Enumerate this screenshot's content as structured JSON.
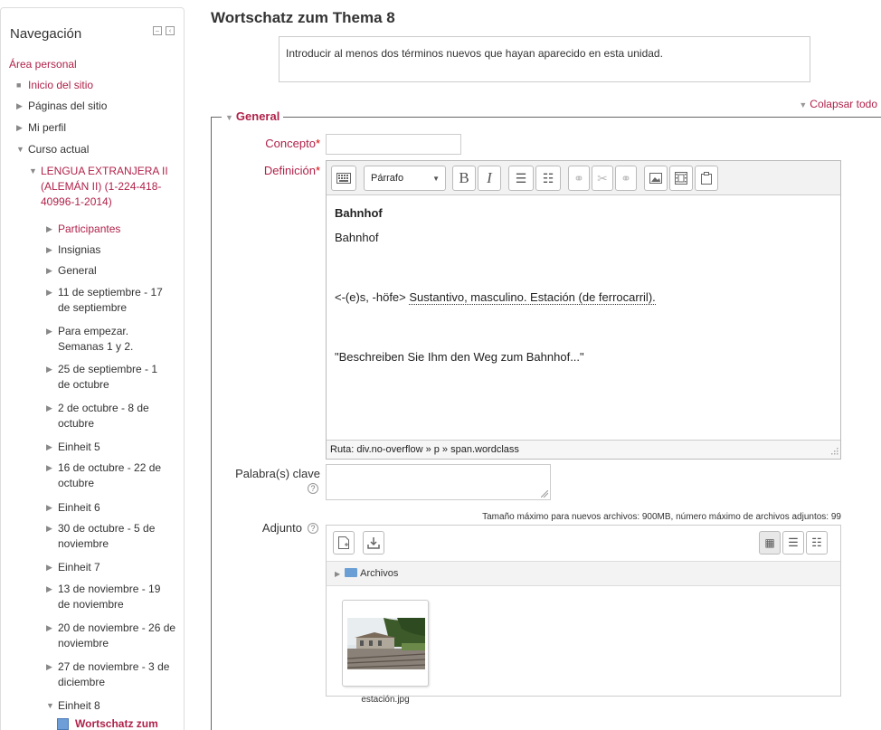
{
  "nav": {
    "title": "Navegación",
    "personal_area": "Área personal",
    "items": [
      {
        "label": "Inicio del sitio"
      },
      {
        "label": "Páginas del sitio"
      },
      {
        "label": "Mi perfil"
      },
      {
        "label": "Curso actual"
      },
      {
        "label": "LENGUA EXTRANJERA II (ALEMÁN II) (1-224-418-40996-1-2014)"
      },
      {
        "label": "Participantes"
      },
      {
        "label": "Insignias"
      },
      {
        "label": "General"
      },
      {
        "label": "11 de septiembre - 17 de septiembre"
      },
      {
        "label": "Para empezar. Semanas 1 y 2."
      },
      {
        "label": "25 de septiembre - 1 de octubre"
      },
      {
        "label": "2 de octubre - 8 de octubre"
      },
      {
        "label": "Einheit 5"
      },
      {
        "label": "16 de octubre - 22 de octubre"
      },
      {
        "label": "Einheit 6"
      },
      {
        "label": "30 de octubre - 5 de noviembre"
      },
      {
        "label": "Einheit 7"
      },
      {
        "label": "13 de noviembre - 19 de noviembre"
      },
      {
        "label": "20 de noviembre - 26 de noviembre"
      },
      {
        "label": "27 de noviembre - 3 de diciembre"
      },
      {
        "label": "Einheit 8"
      },
      {
        "label": "Wortschatz zum"
      }
    ]
  },
  "main": {
    "title": "Wortschatz zum Thema 8",
    "intro": "Introducir al menos dos términos nuevos que hayan aparecido en esta unidad.",
    "collapse_all": "Colapsar todo",
    "section": "General",
    "concept_label": "Concepto",
    "definition_label": "Definición",
    "required_mark": "*",
    "keywords_label": "Palabra(s) clave",
    "attachment_label": "Adjunto",
    "help_glyph": "?"
  },
  "editor": {
    "format": "Párrafo",
    "bold_glyph": "B",
    "italic_glyph": "I",
    "headword": "Bahnhof",
    "line2": "Bahnhof",
    "grammar": "<-(e)s, -höfe> ",
    "wordclass": "Sustantivo, masculino. Estación (de ferrocarril).",
    "example": "\"Beschreiben Sie Ihm den Weg zum Bahnhof...\"",
    "path": "Ruta: div.no-overflow » p » span.wordclass"
  },
  "files": {
    "size_note": "Tamaño máximo para nuevos archivos: 900MB, número máximo de archivos adjuntos: 99",
    "folder": "Archivos",
    "file_name": "estación.jpg"
  },
  "colors": {
    "accent": "#b0224a",
    "required": "#dd0000"
  }
}
